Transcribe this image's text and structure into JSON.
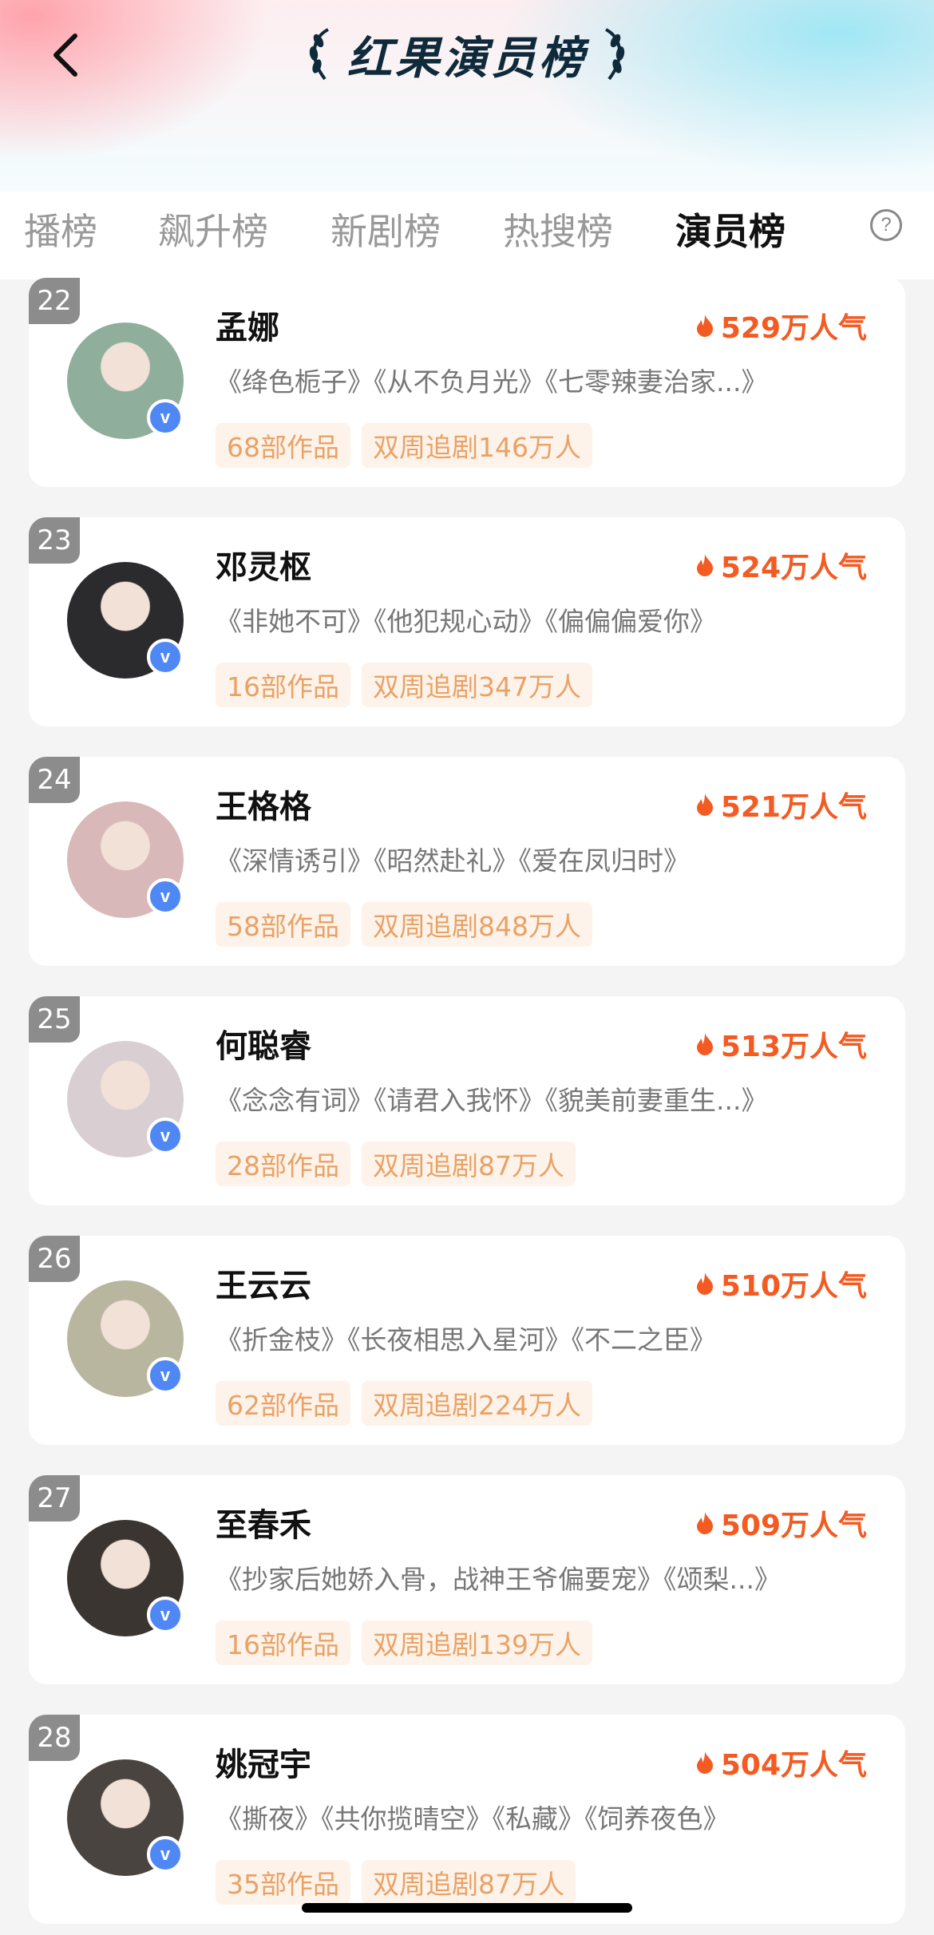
{
  "header": {
    "title": "红果演员榜"
  },
  "tabs": [
    {
      "label": "播榜"
    },
    {
      "label": "飙升榜"
    },
    {
      "label": "新剧榜"
    },
    {
      "label": "热搜榜"
    },
    {
      "label": "演员榜",
      "active": true
    }
  ],
  "actors": [
    {
      "rank": "22",
      "name": "孟娜",
      "popularity": "529万人气",
      "works": "《绛色栀子》《从不负月光》《七零辣妻治家...》",
      "works_count": "68部作品",
      "followers": "双周追剧146万人",
      "avatar_color": "#8fae9c"
    },
    {
      "rank": "23",
      "name": "邓灵枢",
      "popularity": "524万人气",
      "works": "《非她不可》《他犯规心动》《偏偏偏爱你》",
      "works_count": "16部作品",
      "followers": "双周追剧347万人",
      "avatar_color": "#2b2b2e"
    },
    {
      "rank": "24",
      "name": "王格格",
      "popularity": "521万人气",
      "works": "《深情诱引》《昭然赴礼》《爱在凤归时》",
      "works_count": "58部作品",
      "followers": "双周追剧848万人",
      "avatar_color": "#d8b8b8"
    },
    {
      "rank": "25",
      "name": "何聪睿",
      "popularity": "513万人气",
      "works": "《念念有词》《请君入我怀》《貌美前妻重生...》",
      "works_count": "28部作品",
      "followers": "双周追剧87万人",
      "avatar_color": "#d9cfd3"
    },
    {
      "rank": "26",
      "name": "王云云",
      "popularity": "510万人气",
      "works": "《折金枝》《长夜相思入星河》《不二之臣》",
      "works_count": "62部作品",
      "followers": "双周追剧224万人",
      "avatar_color": "#b9b6a0"
    },
    {
      "rank": "27",
      "name": "至春禾",
      "popularity": "509万人气",
      "works": "《抄家后她娇入骨，战神王爷偏要宠》《颂梨...》",
      "works_count": "16部作品",
      "followers": "双周追剧139万人",
      "avatar_color": "#3a3530"
    },
    {
      "rank": "28",
      "name": "姚冠宇",
      "popularity": "504万人气",
      "works": "《撕夜》《共你揽晴空》《私藏》《饲养夜色》",
      "works_count": "35部作品",
      "followers": "双周追剧87万人",
      "avatar_color": "#4a4440"
    }
  ],
  "icons": {
    "back": "chevron-left-icon",
    "help": "question-circle-icon",
    "popularity": "flame-icon",
    "verified": "verified-v-icon"
  },
  "colors": {
    "accent": "#f35b22",
    "tag_text": "#e9a266",
    "tag_bg": "#fdf3ea",
    "verified": "#4f88f5"
  }
}
